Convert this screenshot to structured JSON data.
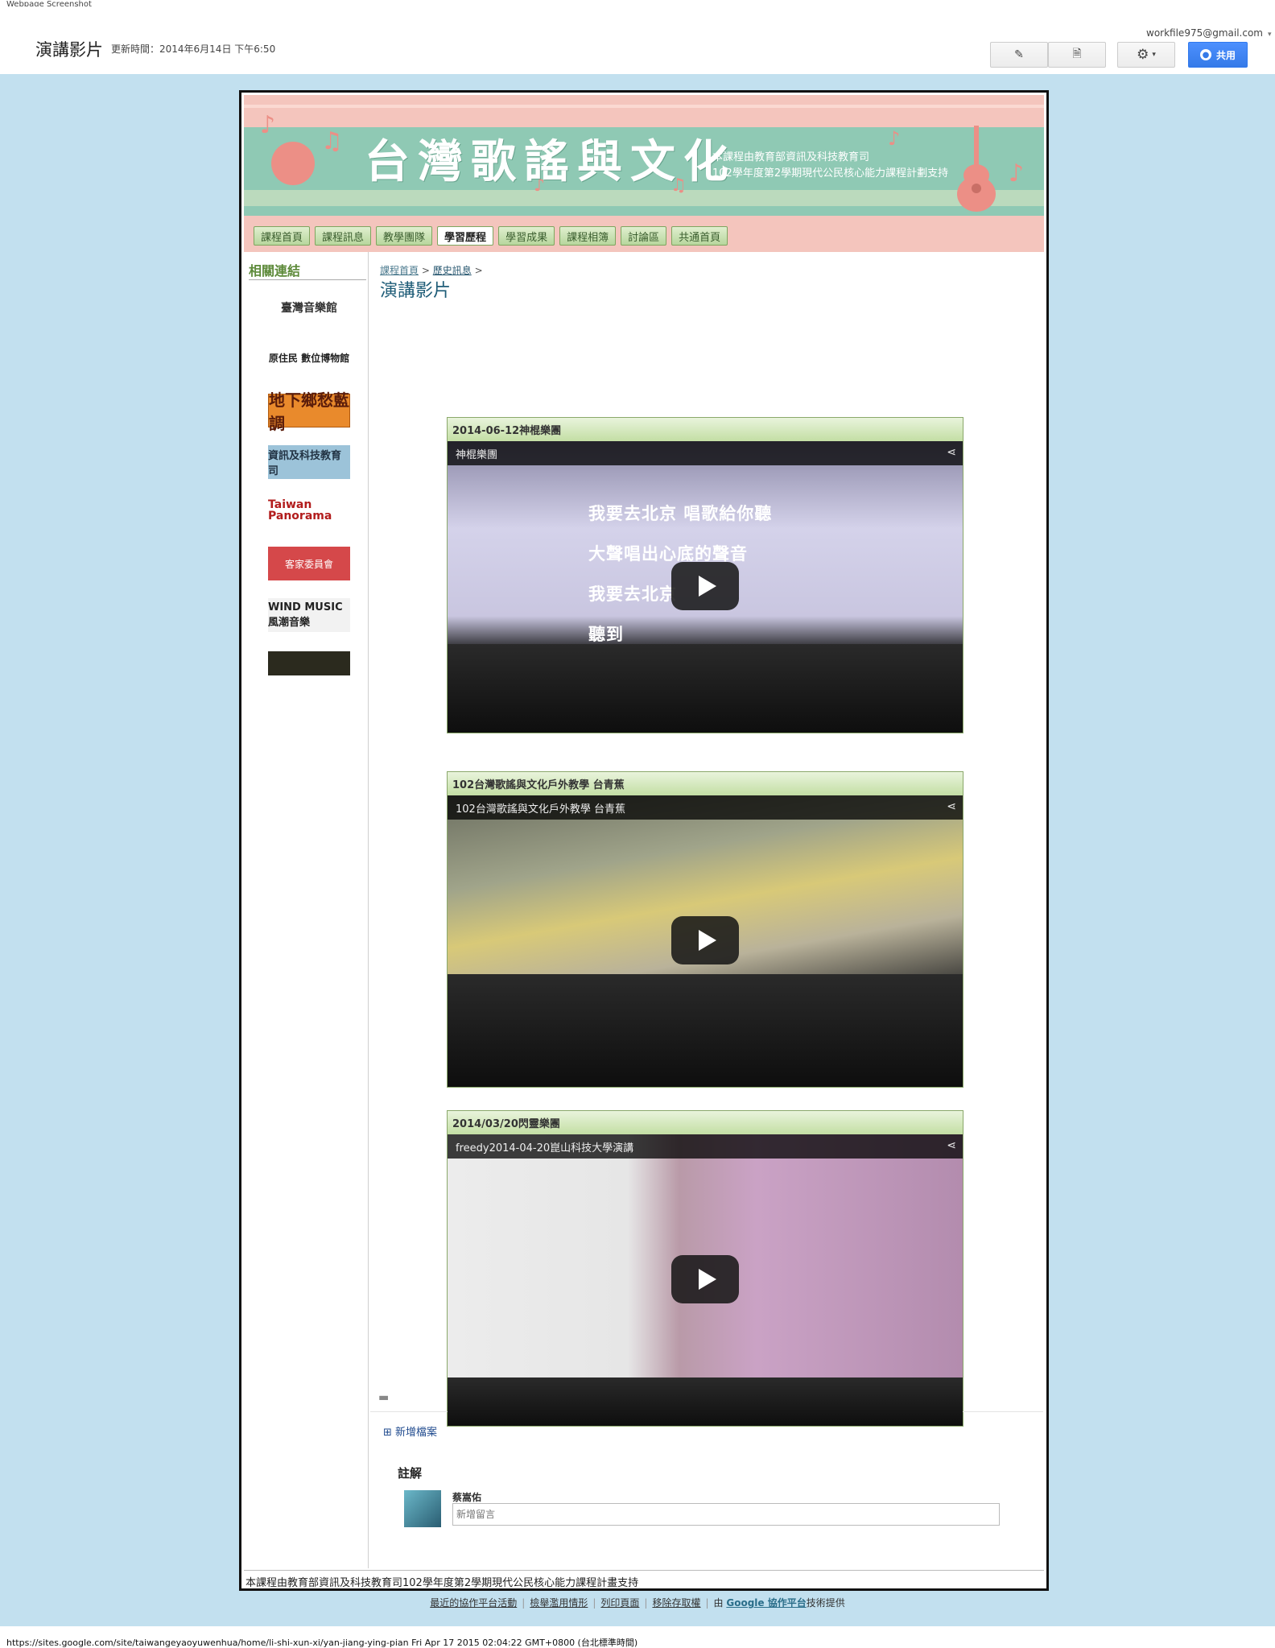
{
  "caption": "Webpage Screenshot",
  "topbar": {
    "page_title": "演講影片",
    "updated": "更新時間：2014年6月14日 下午6:50",
    "account": "workfile975@gmail.com",
    "share_label": "共用",
    "icons": [
      "pencil-icon",
      "new-page-icon",
      "gear-icon"
    ]
  },
  "banner": {
    "title": "台灣歌謠與文化",
    "sub1": "本課程由教育部資訊及科技教育司",
    "sub2": "102學年度第2學期現代公民核心能力課程計劃支持"
  },
  "nav": [
    "課程首頁",
    "課程訊息",
    "教學團隊",
    "學習歷程",
    "學習成果",
    "課程相簿",
    "討論區",
    "共通首頁"
  ],
  "nav_active": "學習歷程",
  "sidebar": {
    "title": "相關連結",
    "logos": [
      "臺灣音樂館",
      "原住民 數位博物館",
      "地下鄉愁藍調",
      "資訊及科技教育司",
      "Taiwan Panorama",
      "客家委員會",
      "WIND MUSIC 風潮音樂",
      ""
    ]
  },
  "main": {
    "breadcrumb": [
      "課程首頁",
      "歷史訊息"
    ],
    "heading": "演講影片",
    "videos": [
      {
        "header": "2014-06-12神棍樂團",
        "title": "神棍樂團",
        "lyrics": [
          "我要去北京 唱歌給你聽",
          "大聲唱出心底的聲音",
          "我要去北京",
          "聽到"
        ]
      },
      {
        "header": "102台灣歌謠與文化戶外教學 台青蕉",
        "title": "102台灣歌謠與文化戶外教學 台青蕉"
      },
      {
        "header": "2014/03/20閃靈樂團",
        "title": "freedy2014-04-20崑山科技大學演講"
      }
    ],
    "add_file": "新增檔案",
    "comments_title": "註解",
    "commenter": "蔡嵩佑",
    "comment_placeholder": "新增留言"
  },
  "site_footer": "本課程由教育部資訊及科技教育司102學年度第2學期現代公民核心能力課程計畫支持",
  "sites_links": {
    "recent": "最近的協作平台活動",
    "abuse": "檢舉濫用情形",
    "print": "列印頁面",
    "remove": "移除存取權",
    "by": "由",
    "google": "Google 協作平台",
    "provided": "技術提供"
  },
  "url_line": "https://sites.google.com/site/taiwangeyaoyuwenhua/home/li-shi-xun-xi/yan-jiang-ying-pian Fri Apr 17 2015 02:04:22 GMT+0800 (台北標準時間)"
}
